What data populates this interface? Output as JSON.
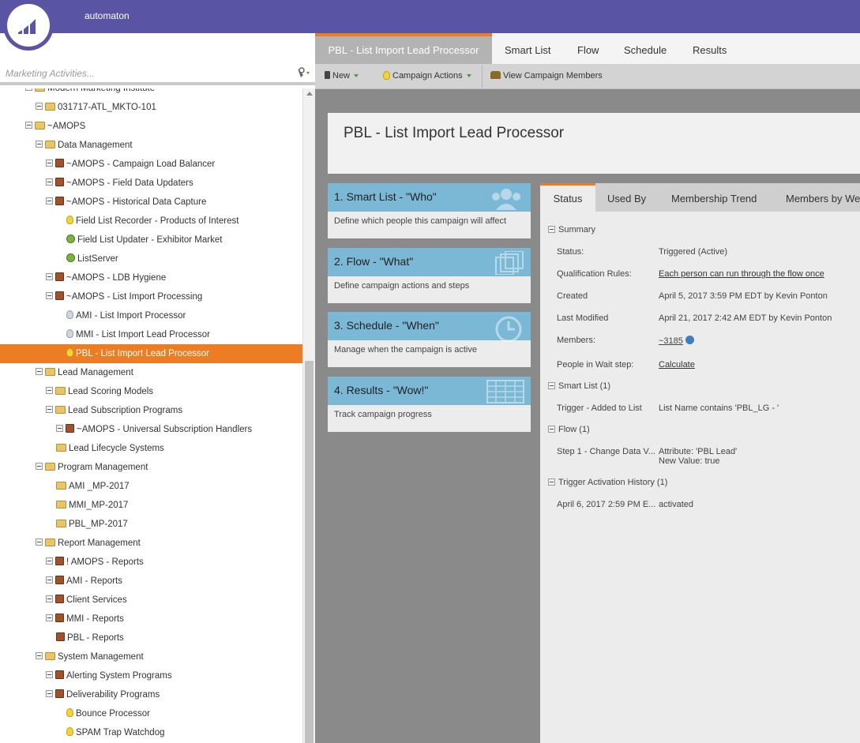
{
  "app": {
    "name": "automaton"
  },
  "search": {
    "placeholder": "Marketing Activities..."
  },
  "tree": [
    {
      "label": "Modern Marketing Institute",
      "indent": 1,
      "exp": true,
      "icon": "folder"
    },
    {
      "label": "031717-ATL_MKTO-101",
      "indent": 2,
      "exp": true,
      "icon": "folder"
    },
    {
      "label": "~AMOPS",
      "indent": 1,
      "exp": true,
      "icon": "folder"
    },
    {
      "label": "Data Management",
      "indent": 2,
      "exp": true,
      "icon": "folder"
    },
    {
      "label": "~AMOPS - Campaign Load Balancer",
      "indent": 3,
      "exp": true,
      "icon": "program"
    },
    {
      "label": "~AMOPS - Field Data Updaters",
      "indent": 3,
      "exp": true,
      "icon": "program"
    },
    {
      "label": "~AMOPS - Historical Data Capture",
      "indent": 3,
      "exp": true,
      "icon": "program"
    },
    {
      "label": "Field List Recorder - Products of Interest",
      "indent": 4,
      "exp": false,
      "icon": "bulb"
    },
    {
      "label": "Field List Updater - Exhibitor Market",
      "indent": 4,
      "exp": false,
      "icon": "gear"
    },
    {
      "label": "ListServer",
      "indent": 4,
      "exp": false,
      "icon": "gear"
    },
    {
      "label": "~AMOPS - LDB Hygiene",
      "indent": 3,
      "exp": true,
      "icon": "program"
    },
    {
      "label": "~AMOPS - List Import Processing",
      "indent": 3,
      "exp": true,
      "icon": "program"
    },
    {
      "label": "AMI - List Import Processor",
      "indent": 4,
      "exp": false,
      "icon": "bulb-grey"
    },
    {
      "label": "MMI - List Import Lead Processor",
      "indent": 4,
      "exp": false,
      "icon": "bulb-grey"
    },
    {
      "label": "PBL - List Import Lead Processor",
      "indent": 4,
      "exp": false,
      "icon": "bulb",
      "selected": true
    },
    {
      "label": "Lead Management",
      "indent": 2,
      "exp": true,
      "icon": "folder"
    },
    {
      "label": "Lead Scoring Models",
      "indent": 3,
      "exp": true,
      "icon": "folder"
    },
    {
      "label": "Lead Subscription Programs",
      "indent": 3,
      "exp": true,
      "icon": "folder"
    },
    {
      "label": "~AMOPS - Universal Subscription Handlers",
      "indent": 4,
      "exp": true,
      "icon": "program"
    },
    {
      "label": "Lead Lifecycle Systems",
      "indent": 3,
      "exp": false,
      "icon": "folder"
    },
    {
      "label": "Program Management",
      "indent": 2,
      "exp": true,
      "icon": "folder"
    },
    {
      "label": "AMI _MP-2017",
      "indent": 3,
      "exp": false,
      "icon": "folder"
    },
    {
      "label": "MMI_MP-2017",
      "indent": 3,
      "exp": false,
      "icon": "folder"
    },
    {
      "label": "PBL_MP-2017",
      "indent": 3,
      "exp": false,
      "icon": "folder"
    },
    {
      "label": "Report Management",
      "indent": 2,
      "exp": true,
      "icon": "folder"
    },
    {
      "label": "! AMOPS - Reports",
      "indent": 3,
      "exp": true,
      "icon": "program"
    },
    {
      "label": "AMI - Reports",
      "indent": 3,
      "exp": true,
      "icon": "program"
    },
    {
      "label": "Client Services",
      "indent": 3,
      "exp": true,
      "icon": "program"
    },
    {
      "label": "MMI - Reports",
      "indent": 3,
      "exp": true,
      "icon": "program"
    },
    {
      "label": "PBL - Reports",
      "indent": 3,
      "exp": false,
      "icon": "program"
    },
    {
      "label": "System Management",
      "indent": 2,
      "exp": true,
      "icon": "folder"
    },
    {
      "label": "Alerting System Programs",
      "indent": 3,
      "exp": true,
      "icon": "program"
    },
    {
      "label": "Deliverability Programs",
      "indent": 3,
      "exp": true,
      "icon": "program"
    },
    {
      "label": "Bounce Processor",
      "indent": 4,
      "exp": false,
      "icon": "bulb"
    },
    {
      "label": "SPAM Trap Watchdog",
      "indent": 4,
      "exp": false,
      "icon": "bulb"
    }
  ],
  "tabs": {
    "main": "PBL - List Import Lead Processor",
    "smart_list": "Smart List",
    "flow": "Flow",
    "schedule": "Schedule",
    "results": "Results"
  },
  "toolbar": {
    "new": "New",
    "campaign_actions": "Campaign Actions",
    "view_members": "View Campaign Members"
  },
  "campaign": {
    "title": "PBL - List Import Lead Processor"
  },
  "steps": [
    {
      "title": "1. Smart List - \"Who\"",
      "desc": "Define which people this campaign will affect"
    },
    {
      "title": "2. Flow - \"What\"",
      "desc": "Define campaign actions and steps"
    },
    {
      "title": "3. Schedule - \"When\"",
      "desc": "Manage when the campaign is active"
    },
    {
      "title": "4. Results - \"Wow!\"",
      "desc": "Track campaign progress"
    }
  ],
  "panel_tabs": {
    "status": "Status",
    "used_by": "Used By",
    "membership_trend": "Membership Trend",
    "members_by": "Members by We"
  },
  "status": {
    "summary": "Summary",
    "status_label": "Status:",
    "status_value": "Triggered (Active)",
    "qual_label": "Qualification Rules:",
    "qual_value": "Each person can run through the flow once",
    "created_label": "Created",
    "created_value": "April 5, 2017 3:59 PM EDT by Kevin Ponton",
    "modified_label": "Last Modified",
    "modified_value": "April 21, 2017 2:42 AM EDT by Kevin Ponton",
    "members_label": "Members:",
    "members_value": "~3185",
    "wait_label": "People in Wait step:",
    "wait_value": "Calculate",
    "smart_list_head": "Smart List (1)",
    "trigger_label": "Trigger - Added to List",
    "trigger_value": "List Name contains 'PBL_LG - '",
    "flow_head": "Flow (1)",
    "step_label": "Step 1 - Change Data V...",
    "step_value_1": "Attribute: 'PBL Lead'",
    "step_value_2": "New Value: true",
    "history_head": "Trigger Activation History (1)",
    "history_label": "April 6, 2017 2:59 PM E...",
    "history_value": "activated"
  }
}
